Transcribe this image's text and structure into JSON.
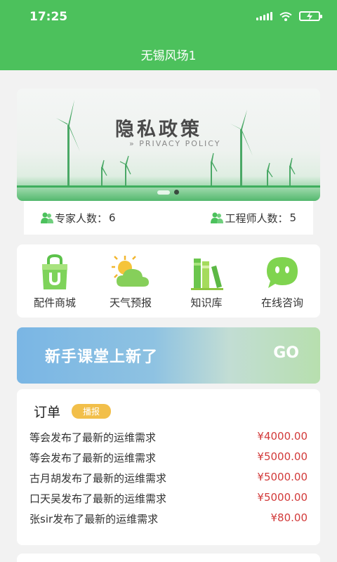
{
  "status_bar": {
    "time": "17:25"
  },
  "header": {
    "title": "无锡风场1"
  },
  "banner": {
    "title": "隐私政策",
    "subtitle": "» PRIVACY POLICY"
  },
  "stats": {
    "experts_label": "专家人数：",
    "experts_count": "6",
    "engineers_label": "工程师人数：",
    "engineers_count": "5"
  },
  "quick_menu": [
    {
      "label": "配件商城",
      "icon": "shopping-bag-icon"
    },
    {
      "label": "天气预报",
      "icon": "weather-icon"
    },
    {
      "label": "知识库",
      "icon": "books-icon"
    },
    {
      "label": "在线咨询",
      "icon": "chat-bubble-icon"
    }
  ],
  "promo": {
    "text": "新手课堂上新了",
    "go": "GO"
  },
  "orders": {
    "title": "订单",
    "badge": "播报",
    "rows": [
      {
        "text": "等会发布了最新的运维需求",
        "price": "¥4000.00"
      },
      {
        "text": "等会发布了最新的运维需求",
        "price": "¥5000.00"
      },
      {
        "text": "古月胡发布了最新的运维需求",
        "price": "¥5000.00"
      },
      {
        "text": "口天吴发布了最新的运维需求",
        "price": "¥5000.00"
      },
      {
        "text": "张sir发布了最新的运维需求",
        "price": "¥80.00"
      }
    ]
  },
  "colors": {
    "brand": "#4cc15c",
    "price": "#d23a3a",
    "badge": "#f2bf4a"
  }
}
